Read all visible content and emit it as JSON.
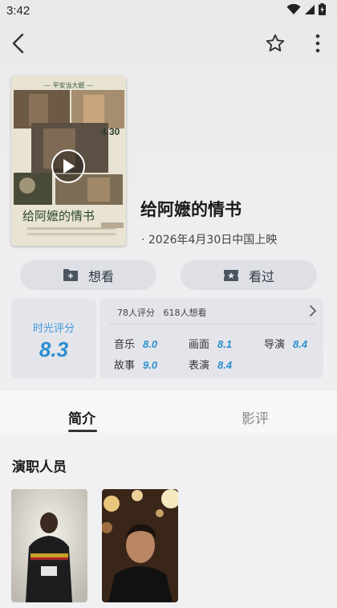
{
  "status_bar": {
    "time": "3:42"
  },
  "appbar": {
    "back_icon": "arrow-left-icon",
    "favorite_icon": "star-outline-icon",
    "more_icon": "more-vertical-icon"
  },
  "movie": {
    "title": "给阿嬷的情书",
    "release_info": "· 2026年4月30日中国上映",
    "poster": {
      "tagline": "— 平安当大嬷 —",
      "date": "4.30",
      "title": "给阿嬷的情书"
    }
  },
  "actions": {
    "want_label": "想看",
    "watched_label": "看过"
  },
  "rating": {
    "label": "时光评分",
    "score": "8.3",
    "summary": "78人评分   618人想看",
    "subscores": [
      {
        "name": "音乐",
        "score": "8.0"
      },
      {
        "name": "画面",
        "score": "8.1"
      },
      {
        "name": "导演",
        "score": "8.4"
      },
      {
        "name": "故事",
        "score": "9.0"
      },
      {
        "name": "表演",
        "score": "8.4"
      }
    ]
  },
  "tabs": [
    {
      "label": "简介",
      "active": true
    },
    {
      "label": "影评",
      "active": false
    }
  ],
  "cast_section": {
    "title": "演职人员"
  },
  "colors": {
    "accent_blue": "#2b8fd0",
    "button_bg": "#dfe0e6"
  }
}
